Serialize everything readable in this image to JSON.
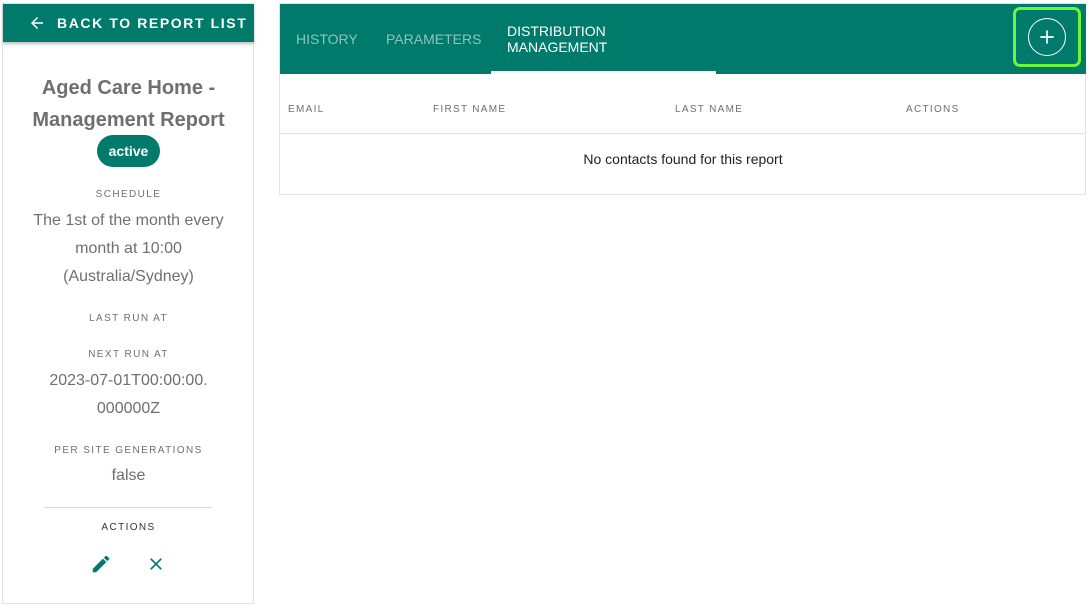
{
  "back_button": {
    "label": "BACK TO REPORT LIST",
    "icon": "arrow-left-icon"
  },
  "report": {
    "title": "Aged Care Home - Management Report",
    "status": "active",
    "schedule_label": "SCHEDULE",
    "schedule_value": "The 1st of the month every month at 10:00 (Australia/Sydney)",
    "last_run_label": "LAST RUN AT",
    "last_run_value": "",
    "next_run_label": "NEXT RUN AT",
    "next_run_value": "2023-07-01T00:00:00.000000Z",
    "per_site_label": "PER SITE GENERATIONS",
    "per_site_value": "false",
    "actions_label": "ACTIONS"
  },
  "tabs": [
    {
      "label": "HISTORY",
      "active": false
    },
    {
      "label": "PARAMETERS",
      "active": false
    },
    {
      "label": "DISTRIBUTION MANAGEMENT",
      "active": true
    }
  ],
  "table": {
    "columns": [
      "EMAIL",
      "FIRST NAME",
      "LAST NAME",
      "ACTIONS"
    ],
    "empty_message": "No contacts found for this report"
  },
  "colors": {
    "primary": "#007a6a",
    "highlight": "#6ff53a"
  },
  "icons": {
    "edit": "pencil-icon",
    "delete": "close-icon",
    "add": "plus-circle-icon"
  }
}
